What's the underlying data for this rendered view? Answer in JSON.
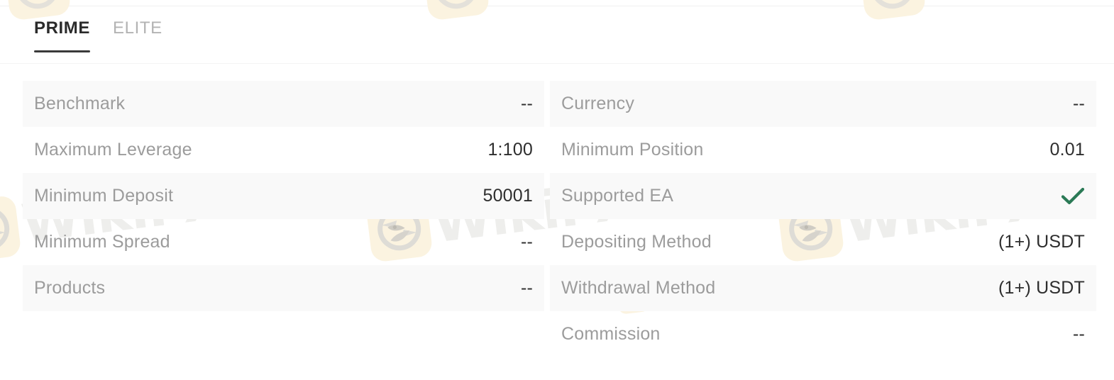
{
  "tabs": [
    {
      "label": "PRIME",
      "active": true
    },
    {
      "label": "ELITE",
      "active": false
    }
  ],
  "colors": {
    "accent_check": "#2b7a56",
    "active_tab_text": "#2b2b2b",
    "inactive_tab_text": "#b3b3b3",
    "label_text": "#9c9c9c",
    "value_text": "#2e2e2e",
    "row_stripe": "#f9f9f9",
    "watermark_badge": "#fbf3e0",
    "watermark_text": "#eeeeec"
  },
  "left_column": [
    {
      "label": "Benchmark",
      "value": "--",
      "striped": true
    },
    {
      "label": "Maximum Leverage",
      "value": "1:100",
      "striped": false
    },
    {
      "label": "Minimum Deposit",
      "value": "50001",
      "striped": true
    },
    {
      "label": "Minimum Spread",
      "value": "--",
      "striped": false
    },
    {
      "label": "Products",
      "value": "--",
      "striped": true
    }
  ],
  "right_column": [
    {
      "label": "Currency",
      "value": "--",
      "striped": true,
      "icon": null
    },
    {
      "label": "Minimum Position",
      "value": "0.01",
      "striped": false,
      "icon": null
    },
    {
      "label": "Supported EA",
      "value": "",
      "striped": true,
      "icon": "check-icon"
    },
    {
      "label": "Depositing Method",
      "value": "(1+) USDT",
      "striped": false,
      "icon": null
    },
    {
      "label": "Withdrawal Method",
      "value": "(1+) USDT",
      "striped": true,
      "icon": null
    },
    {
      "label": "Commission",
      "value": "--",
      "striped": false,
      "icon": null
    }
  ],
  "watermark": {
    "text": "WikiFX",
    "logo": "wikifx-eagle-logo"
  }
}
